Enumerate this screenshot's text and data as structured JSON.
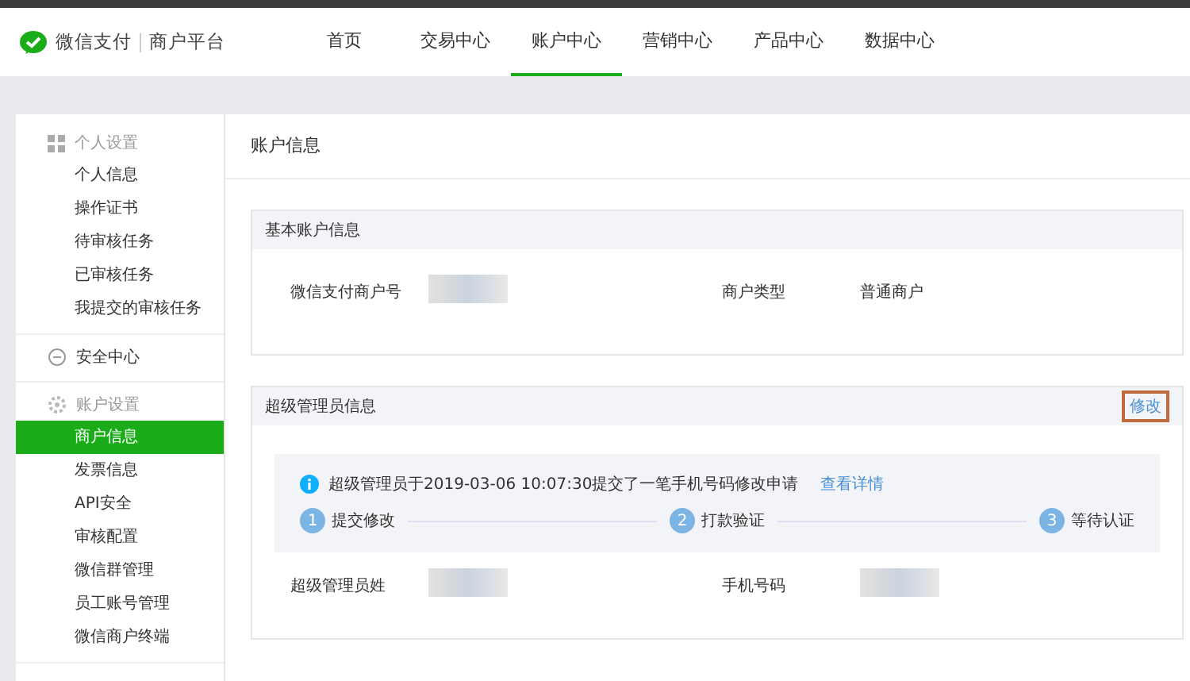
{
  "header": {
    "brand": "微信支付",
    "platform": "商户平台"
  },
  "nav": [
    {
      "label": "首页",
      "selected": false
    },
    {
      "label": "交易中心",
      "selected": false
    },
    {
      "label": "账户中心",
      "selected": true
    },
    {
      "label": "营销中心",
      "selected": false
    },
    {
      "label": "产品中心",
      "selected": false
    },
    {
      "label": "数据中心",
      "selected": false
    }
  ],
  "sidebar": {
    "groups": [
      {
        "title": "个人设置",
        "items": [
          {
            "label": "个人信息",
            "selected": false
          },
          {
            "label": "操作证书",
            "selected": false
          },
          {
            "label": "待审核任务",
            "selected": false
          },
          {
            "label": "已审核任务",
            "selected": false
          },
          {
            "label": "我提交的审核任务",
            "selected": false
          }
        ]
      },
      {
        "title": "安全中心"
      },
      {
        "title": "账户设置",
        "items": [
          {
            "label": "商户信息",
            "selected": true
          },
          {
            "label": "发票信息",
            "selected": false
          },
          {
            "label": "API安全",
            "selected": false
          },
          {
            "label": "审核配置",
            "selected": false
          },
          {
            "label": "微信群管理",
            "selected": false
          },
          {
            "label": "员工账号管理",
            "selected": false
          },
          {
            "label": "微信商户终端",
            "selected": false
          }
        ]
      }
    ]
  },
  "page_title": "账户信息",
  "basic_card": {
    "title": "基本账户信息",
    "fields": [
      {
        "label": "微信支付商户号",
        "redacted": true
      },
      {
        "label": "商户类型",
        "value": "普通商户"
      }
    ]
  },
  "admin_card": {
    "title": "超级管理员信息",
    "action": "修改",
    "notice": {
      "text": "超级管理员于2019-03-06 10:07:30提交了一笔手机号码修改申请",
      "link": "查看详情"
    },
    "steps": [
      {
        "number": "1",
        "label": "提交修改"
      },
      {
        "number": "2",
        "label": "打款验证"
      },
      {
        "number": "3",
        "label": "等待认证"
      }
    ],
    "fields": [
      {
        "label": "超级管理员姓",
        "redacted": true
      },
      {
        "label": "手机号码",
        "redacted": true
      }
    ]
  }
}
